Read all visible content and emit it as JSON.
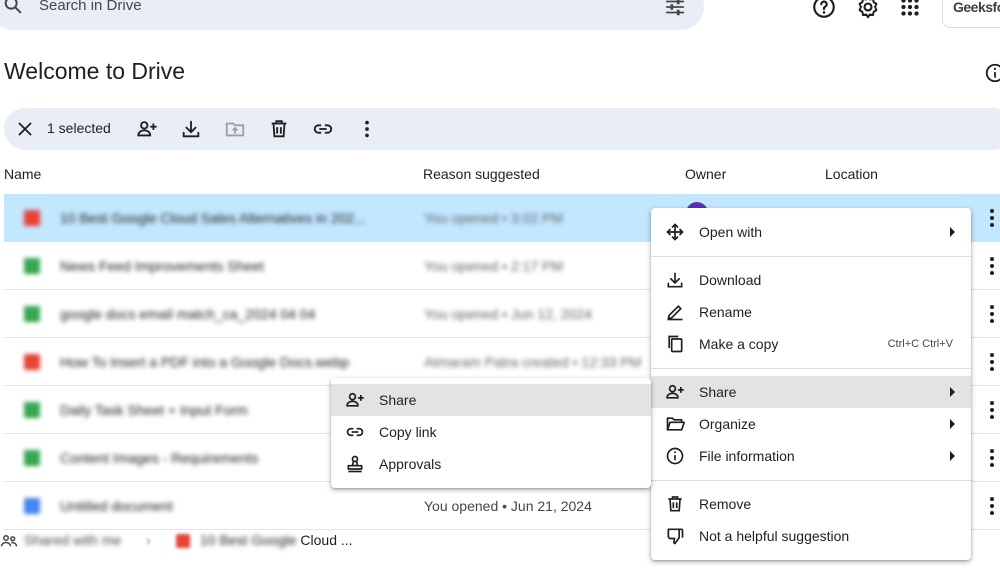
{
  "search": {
    "placeholder": "Search in Drive"
  },
  "header": {
    "title": "Welcome to Drive",
    "account_label": "GeeksforG"
  },
  "toolbar": {
    "selected_count": "1 selected"
  },
  "columns": {
    "name": "Name",
    "reason": "Reason suggested",
    "owner": "Owner",
    "location": "Location"
  },
  "files": [
    {
      "name": "10 Best Google Cloud Sales Alternatives in 202...",
      "reason": "You opened • 3:02 PM",
      "icon_color": "#ea4335"
    },
    {
      "name": "News Feed Improvements Sheet",
      "reason": "You opened • 2:17 PM",
      "icon_color": "#34a853"
    },
    {
      "name": "google docs email match_ca_2024 04 04",
      "reason": "You opened • Jun 12, 2024",
      "icon_color": "#34a853"
    },
    {
      "name": "How To Insert a PDF into a Google Docs.webp",
      "reason": "Atmaram Patra created • 12:33 PM",
      "icon_color": "#ea4335"
    },
    {
      "name": "Daily Task Sheet + Input Form",
      "reason": "",
      "icon_color": "#34a853"
    },
    {
      "name": "Content Images - Requirements",
      "reason": "",
      "icon_color": "#34a853"
    },
    {
      "name": "Untitled document",
      "reason": "You opened • Jun 21, 2024",
      "icon_color": "#4285f4"
    }
  ],
  "shared": {
    "label": "Shared with me",
    "file_prefix": "10 Best Google ",
    "file_suffix": "Cloud ..."
  },
  "context_menu": {
    "open_with": "Open with",
    "download": "Download",
    "rename": "Rename",
    "make_copy": "Make a copy",
    "make_copy_shortcut": "Ctrl+C Ctrl+V",
    "share": "Share",
    "organize": "Organize",
    "file_info": "File information",
    "remove": "Remove",
    "not_helpful": "Not a helpful suggestion"
  },
  "share_submenu": {
    "share": "Share",
    "copy_link": "Copy link",
    "approvals": "Approvals"
  },
  "colors": {
    "selected_row": "#c2e7ff",
    "toolbar_bg": "#e9eef6",
    "menu_highlight": "#e3e3e3"
  }
}
